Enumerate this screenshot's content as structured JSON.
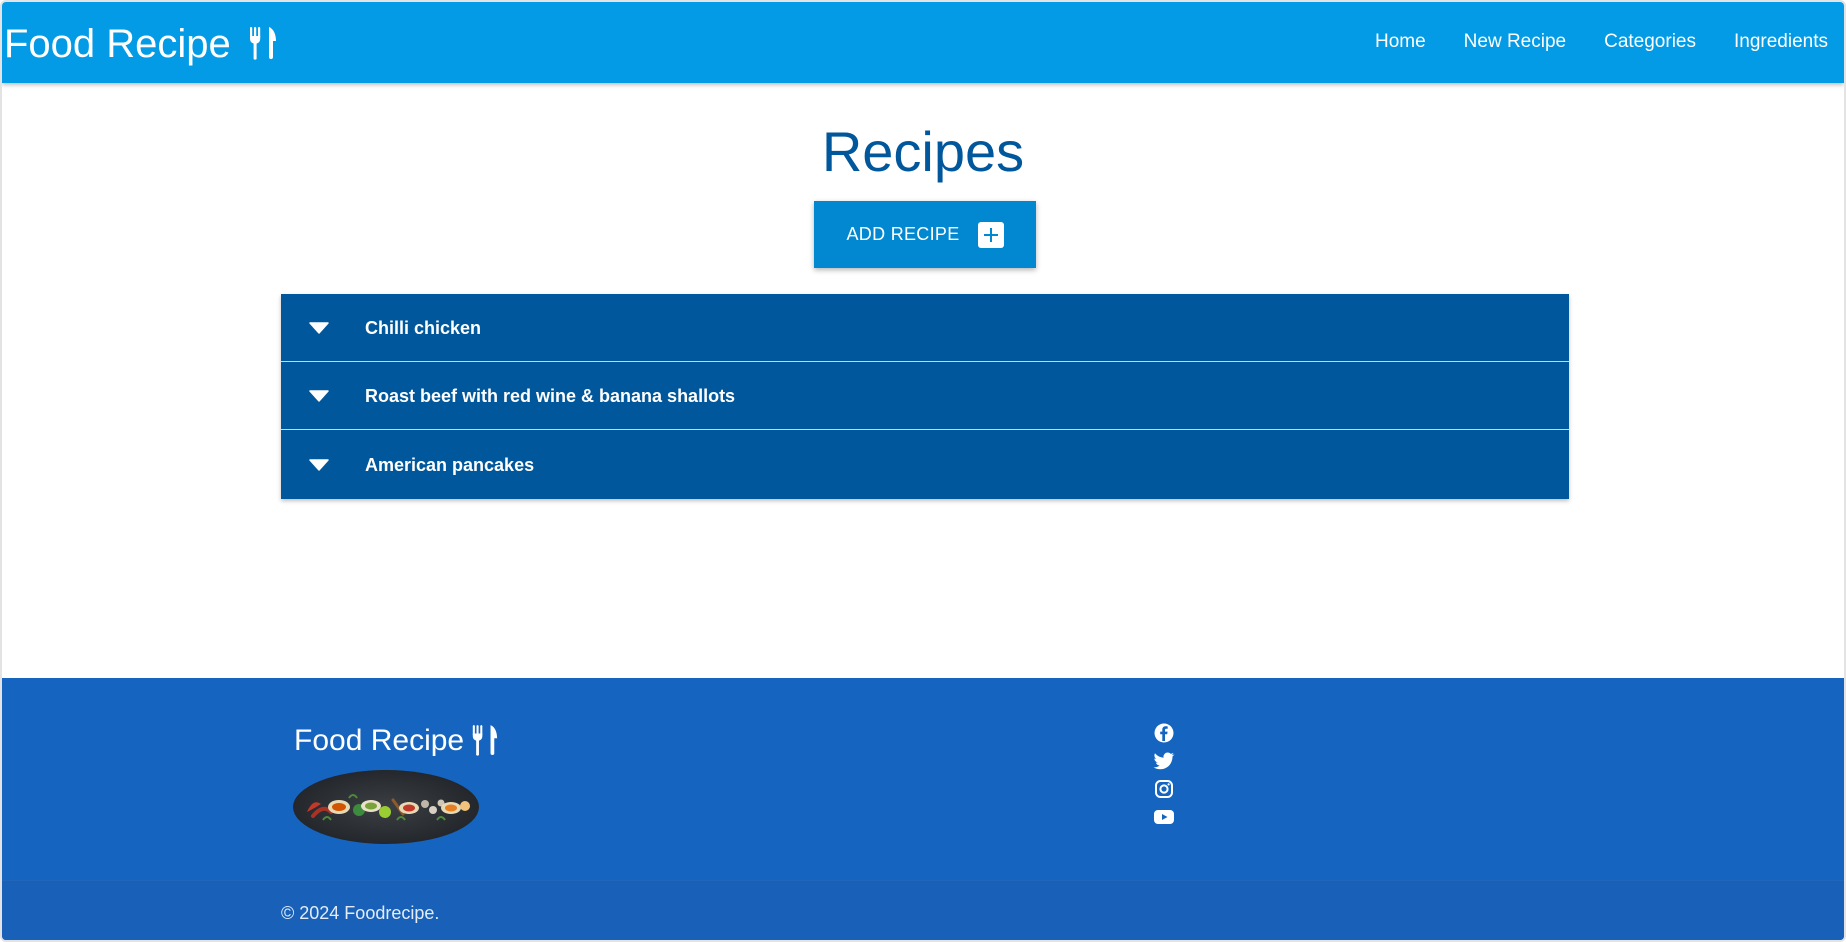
{
  "navbar": {
    "brand": "Food Recipe",
    "brand_icon": "utensils-icon",
    "links": [
      "Home",
      "New Recipe",
      "Categories",
      "Ingredients"
    ]
  },
  "main": {
    "title": "Recipes",
    "add_button_label": "ADD RECIPE",
    "add_button_icon": "plus-square-icon",
    "recipes": [
      "Chilli chicken",
      "Roast beef with red wine & banana shallots",
      "American pancakes"
    ]
  },
  "footer": {
    "brand": "Food Recipe",
    "brand_icon": "utensils-icon",
    "image": "spices-banner-image",
    "social_icons": [
      "facebook-icon",
      "twitter-icon",
      "instagram-icon",
      "youtube-icon"
    ],
    "copyright": "© 2024 Foodrecipe."
  },
  "colors": {
    "navbar": "#039be5",
    "title": "#01579b",
    "button": "#0288d1",
    "recipe_row": "#01579b",
    "footer": "#1565c0"
  }
}
